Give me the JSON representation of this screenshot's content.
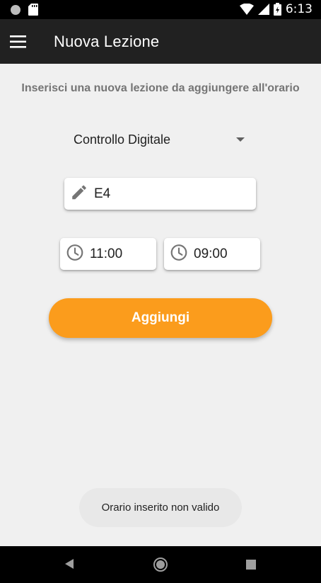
{
  "status_bar": {
    "time": "6:13"
  },
  "app_bar": {
    "title": "Nuova Lezione"
  },
  "form": {
    "subtitle": "Inserisci una nuova lezione da aggiungere all'orario",
    "course_selected": "Controllo Digitale",
    "room_value": "E4",
    "start_time": "11:00",
    "end_time": "09:00",
    "add_label": "Aggiungi"
  },
  "toast": {
    "message": "Orario inserito non valido"
  },
  "colors": {
    "accent": "#fb9c1c",
    "app_bar": "#212121",
    "background": "#f0f0f0"
  },
  "icons": {
    "menu": "menu-icon",
    "edit": "pencil-icon",
    "clock": "clock-icon",
    "back": "back-icon",
    "home": "home-icon",
    "recents": "recents-icon"
  }
}
